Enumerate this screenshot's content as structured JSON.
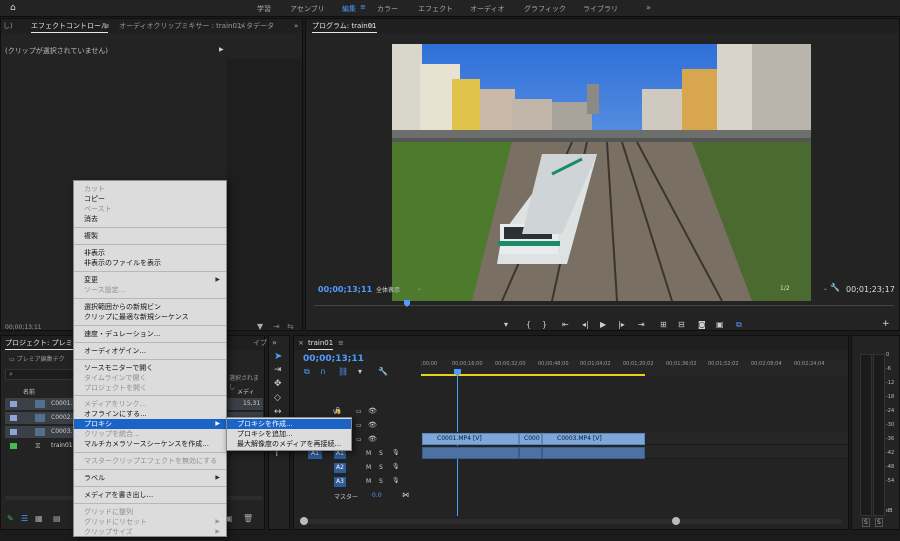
{
  "workspaces": [
    "学習",
    "アセンブリ",
    "編集",
    "カラー",
    "エフェクト",
    "オーディオ",
    "グラフィック",
    "ライブラリ"
  ],
  "active_workspace": "編集",
  "source_panel": {
    "tab_partial": "し)",
    "tabs": [
      "エフェクトコントロール",
      "オーディオクリップミキサー : train01",
      "メタデータ"
    ],
    "empty_text": "(クリップが選択されていません)",
    "timecode": "00;00;13;11"
  },
  "program": {
    "title": "プログラム: train01",
    "timecode_in": "00;00;13;11",
    "fit_label": "全体表示",
    "resolution": "1/2",
    "timecode_out": "00;01;23;17"
  },
  "project": {
    "title": "プロジェクト: プレミア編",
    "folder": "プレミア編集テク",
    "right_partial": "イブラ",
    "right_partial2": "選択されまし",
    "col_name": "名前",
    "col_right": "メディ",
    "items": [
      {
        "name": "C0001.MP",
        "val": "15,31"
      },
      {
        "name": "C0002.MP",
        "val": ""
      },
      {
        "name": "C0003.MP",
        "val": ""
      },
      {
        "name": "train01",
        "val": ""
      }
    ]
  },
  "context_menu": {
    "items": [
      {
        "label": "カット",
        "disabled": true
      },
      {
        "label": "コピー",
        "disabled": false
      },
      {
        "label": "ペースト",
        "disabled": true
      },
      {
        "label": "消去",
        "disabled": false
      },
      {
        "label": "複製",
        "disabled": false
      },
      {
        "label": "非表示",
        "disabled": false
      },
      {
        "label": "非表示のファイルを表示",
        "disabled": false
      },
      {
        "label": "変更",
        "disabled": false,
        "submenu": true
      },
      {
        "label": "ソース設定...",
        "disabled": true
      },
      {
        "label": "選択範囲からの新規ビン",
        "disabled": false
      },
      {
        "label": "クリップに最適な新規シーケンス",
        "disabled": false
      },
      {
        "label": "速度・デュレーション...",
        "disabled": false
      },
      {
        "label": "オーディオゲイン...",
        "disabled": false
      },
      {
        "label": "ソースモニターで開く",
        "disabled": false
      },
      {
        "label": "タイムラインで開く",
        "disabled": true
      },
      {
        "label": "プロジェクトを開く",
        "disabled": true
      },
      {
        "label": "メディアをリンク...",
        "disabled": true
      },
      {
        "label": "オフラインにする...",
        "disabled": false
      },
      {
        "label": "プロキシ",
        "disabled": false,
        "submenu": true,
        "highlighted": true
      },
      {
        "label": "クリップを統合...",
        "disabled": true
      },
      {
        "label": "マルチカメラソースシーケンスを作成...",
        "disabled": false
      },
      {
        "label": "マスタークリップエフェクトを無効にする",
        "disabled": true
      },
      {
        "label": "ラベル",
        "disabled": false,
        "submenu": true
      },
      {
        "label": "メディアを書き出し...",
        "disabled": false
      },
      {
        "label": "グリッドに整列",
        "disabled": true
      },
      {
        "label": "グリッドにリセット",
        "disabled": true,
        "submenu": true
      },
      {
        "label": "クリップサイズ",
        "disabled": true,
        "submenu": true
      }
    ]
  },
  "proxy_submenu": [
    "プロキシを作成...",
    "プロキシを追加...",
    "最大解像度のメディアを再接続..."
  ],
  "timeline": {
    "tab": "train01",
    "timecode": "00;00;13;11",
    "ruler": [
      ";00;00",
      "00;00;16;00",
      "00;00;32;00",
      "00;00;48;00",
      "00;01;04;02",
      "00;01;20;02",
      "00;01;36;02",
      "00;01;52;02",
      "00;02;08;04",
      "00;02;24;04"
    ],
    "video_tracks": [
      "V3",
      "V2",
      "V1"
    ],
    "audio_tracks": [
      "A1",
      "A2",
      "A3"
    ],
    "source_patch_v": "V1",
    "source_patch_a": "A1",
    "master_label": "マスター",
    "master_value": "0.0",
    "clips": [
      "C0001.MP4 [V]",
      "C000",
      "C0003.MP4 [V]"
    ]
  },
  "meters": {
    "scale": [
      "0",
      "-6",
      "-12",
      "-18",
      "-24",
      "-30",
      "-36",
      "-42",
      "-48",
      "-54",
      "dB"
    ],
    "solo": [
      "S",
      "S"
    ]
  },
  "colors": {
    "accent": "#4f9cff",
    "menu_highlight": "#1a64c8",
    "clip_video": "#7ea7d9",
    "clip_audio": "#4d71a3"
  }
}
